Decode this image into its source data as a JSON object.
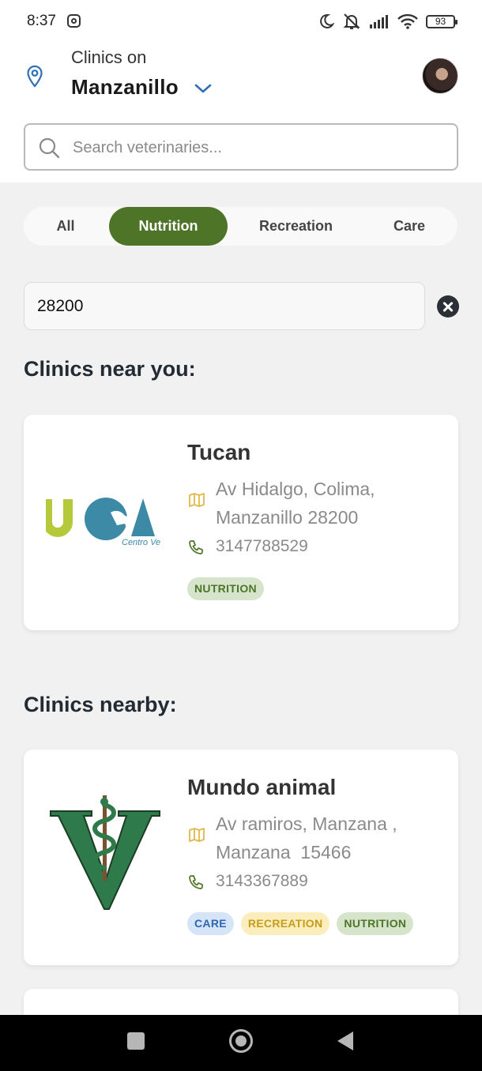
{
  "status_bar": {
    "time": "8:37",
    "battery": "93",
    "icons": [
      "instagram-icon",
      "do-not-disturb-icon",
      "mute-icon",
      "signal-icon",
      "wifi-icon",
      "battery-icon"
    ]
  },
  "header": {
    "subtitle": "Clinics on",
    "city": "Manzanillo",
    "icons": [
      "location-pin-icon",
      "chevron-down-icon",
      "avatar"
    ]
  },
  "search": {
    "placeholder": "Search veterinaries...",
    "value": ""
  },
  "filter_tabs": {
    "items": [
      {
        "label": "All",
        "active": false
      },
      {
        "label": "Nutrition",
        "active": true
      },
      {
        "label": "Recreation",
        "active": false
      },
      {
        "label": "Care",
        "active": false
      }
    ],
    "active_color": "#4d7427"
  },
  "zip_filter": {
    "value": "28200"
  },
  "sections": {
    "near_title": "Clinics near you:",
    "nearby_title": "Clinics nearby:"
  },
  "clinics_near": [
    {
      "name": "Tucan",
      "address": "Av Hidalgo, Colima, Manzanillo 28200",
      "phone": "3147788529",
      "tags": [
        "NUTRITION"
      ],
      "logo_text": "Centro Ve"
    }
  ],
  "clinics_nearby": [
    {
      "name": "Mundo animal",
      "address": "Av ramiros, Manzana , Manzana  15466",
      "phone": "3143367889",
      "tags": [
        "CARE",
        "RECREATION",
        "NUTRITION"
      ]
    }
  ],
  "tag_colors": {
    "NUTRITION": "#4d7427",
    "CARE": "#2f65b2",
    "RECREATION": "#c79c1a"
  }
}
